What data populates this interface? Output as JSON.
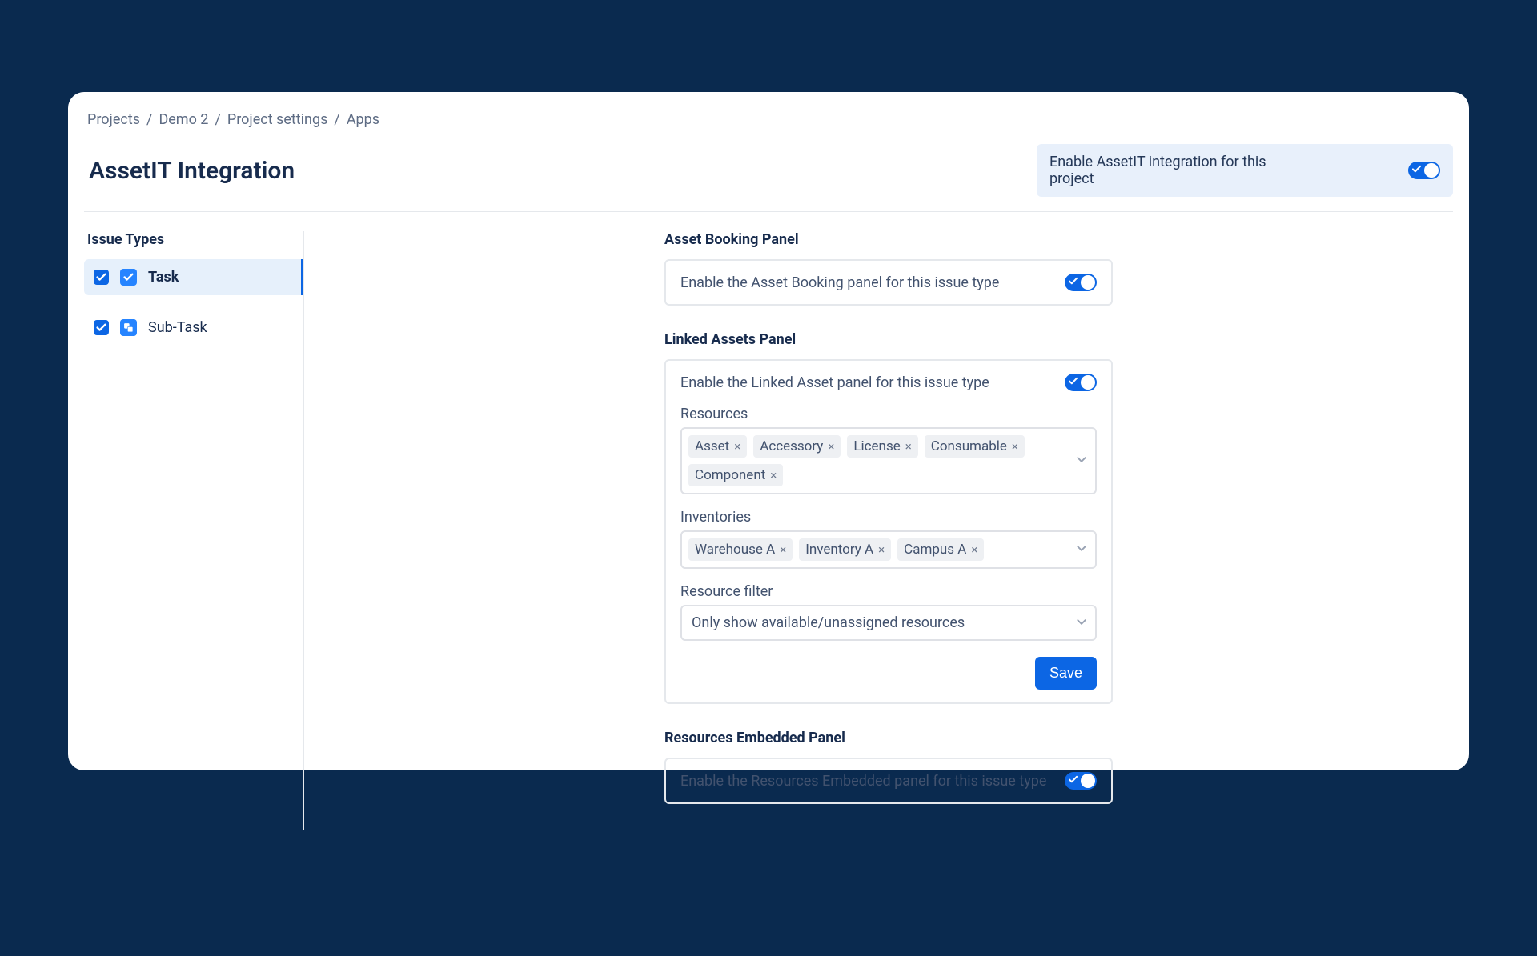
{
  "breadcrumb": [
    "Projects",
    "Demo 2",
    "Project settings",
    "Apps"
  ],
  "page_title": "AssetIT Integration",
  "enable_banner": {
    "label": "Enable AssetIT integration for this project",
    "on": true
  },
  "issue_types": {
    "heading": "Issue Types",
    "items": [
      {
        "label": "Task",
        "checked": true,
        "selected": true,
        "icon": "task"
      },
      {
        "label": "Sub-Task",
        "checked": true,
        "selected": false,
        "icon": "subtask"
      }
    ]
  },
  "booking_panel": {
    "heading": "Asset Booking Panel",
    "desc": "Enable the Asset Booking panel for this issue type",
    "on": true
  },
  "linked_panel": {
    "heading": "Linked Assets Panel",
    "desc": "Enable the Linked Asset panel for this issue type",
    "on": true,
    "resources_label": "Resources",
    "resources": [
      "Asset",
      "Accessory",
      "License",
      "Consumable",
      "Component"
    ],
    "inventories_label": "Inventories",
    "inventories": [
      "Warehouse A",
      "Inventory A",
      "Campus A"
    ],
    "filter_label": "Resource filter",
    "filter_value": "Only show available/unassigned resources",
    "save_label": "Save"
  },
  "embedded_panel": {
    "heading": "Resources Embedded Panel",
    "desc": "Enable the Resources Embedded panel for this issue type",
    "on": true
  }
}
